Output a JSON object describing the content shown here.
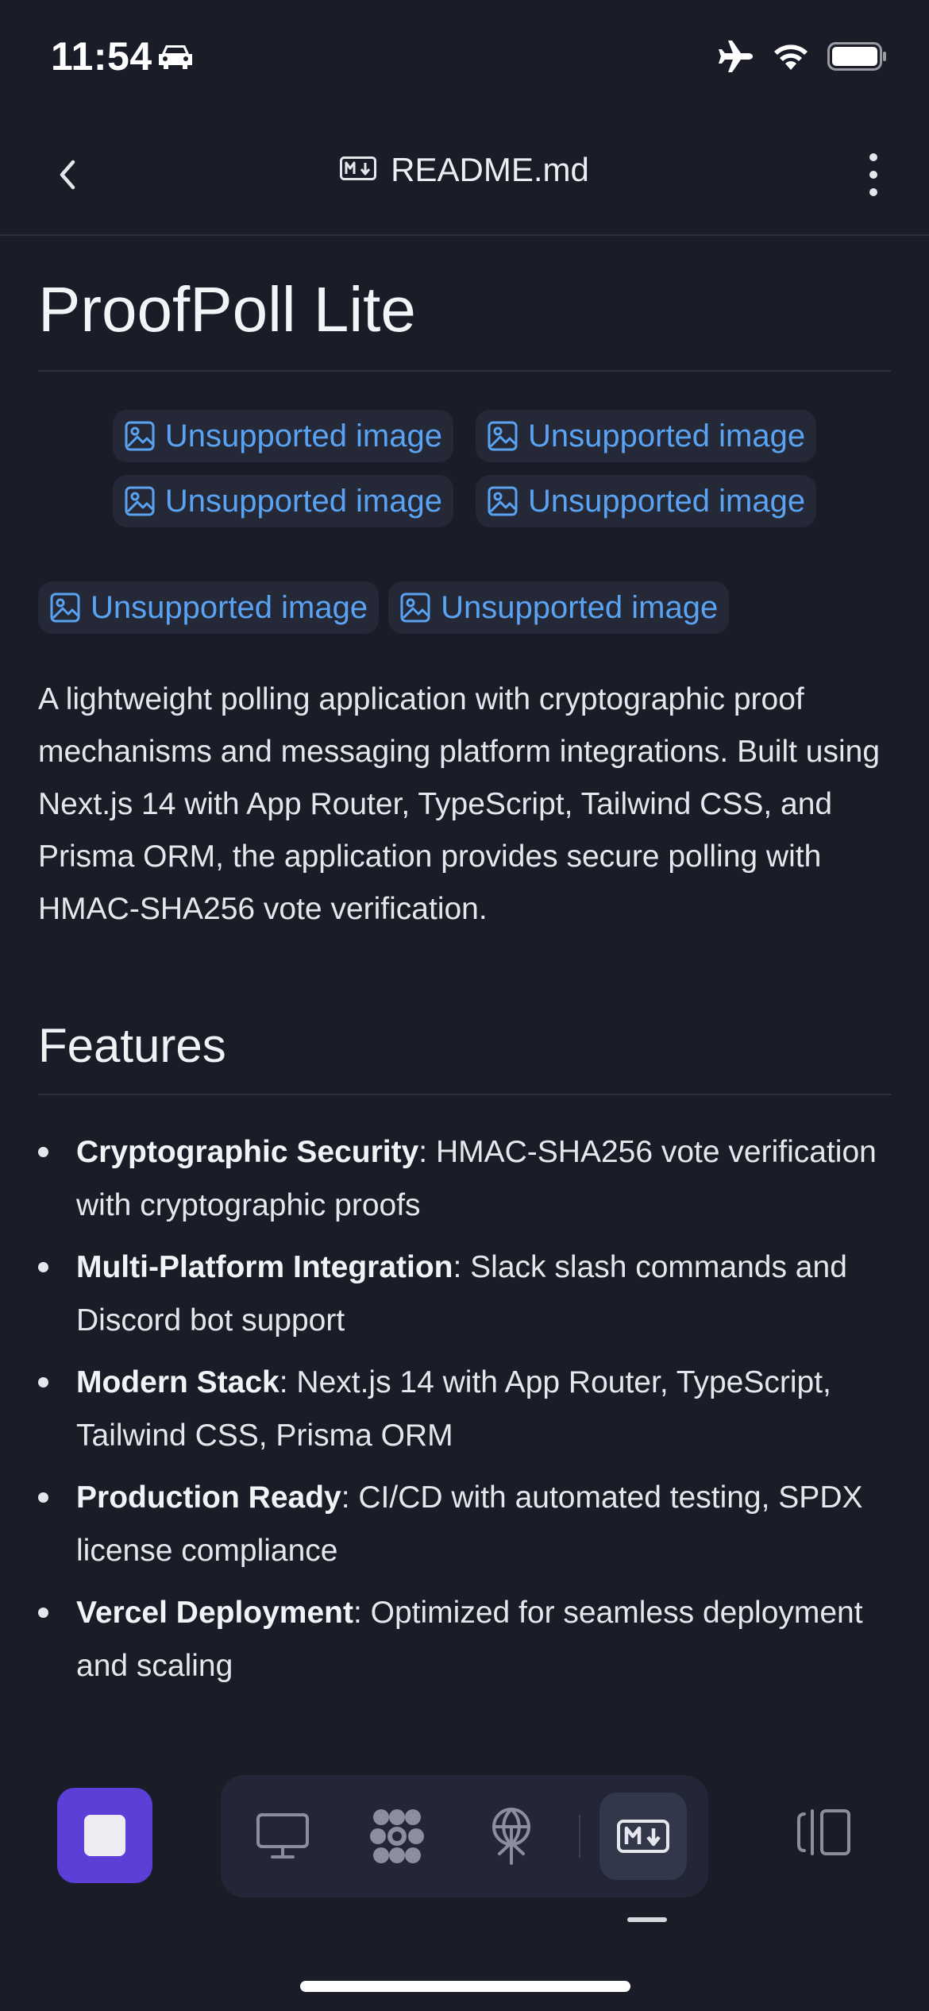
{
  "status_bar": {
    "time": "11:54"
  },
  "nav": {
    "file_name": "README.md"
  },
  "readme": {
    "title": "ProofPoll Lite",
    "badges_row1": [
      "Unsupported image",
      "Unsupported image"
    ],
    "badges_row2": [
      "Unsupported image",
      "Unsupported image"
    ],
    "badges_row3": [
      "Unsupported image",
      "Unsupported image"
    ],
    "description": "A lightweight polling application with cryptographic proof mechanisms and messaging platform integrations. Built using Next.js 14 with App Router, TypeScript, Tailwind CSS, and Prisma ORM, the application provides secure polling with HMAC-SHA256 vote verification.",
    "features_heading": "Features",
    "features": [
      {
        "title": "Cryptographic Security",
        "text": ": HMAC-SHA256 vote verification with cryptographic proofs"
      },
      {
        "title": "Multi-Platform Integration",
        "text": ": Slack slash commands and Discord bot support"
      },
      {
        "title": "Modern Stack",
        "text": ": Next.js 14 with App Router, TypeScript, Tailwind CSS, Prisma ORM"
      },
      {
        "title": "Production Ready",
        "text": ": CI/CD with automated testing, SPDX license compliance"
      },
      {
        "title": "Vercel Deployment",
        "text": ": Optimized for seamless deployment and scaling"
      }
    ]
  },
  "bottom_bar": {
    "tabs": [
      "monitor-icon",
      "flower-icon",
      "antenna-icon",
      "markdown-icon"
    ],
    "active_tab": "markdown-icon"
  },
  "colors": {
    "background": "#1a1c28",
    "link": "#5aa3f2",
    "accent": "#5b3fd6"
  }
}
